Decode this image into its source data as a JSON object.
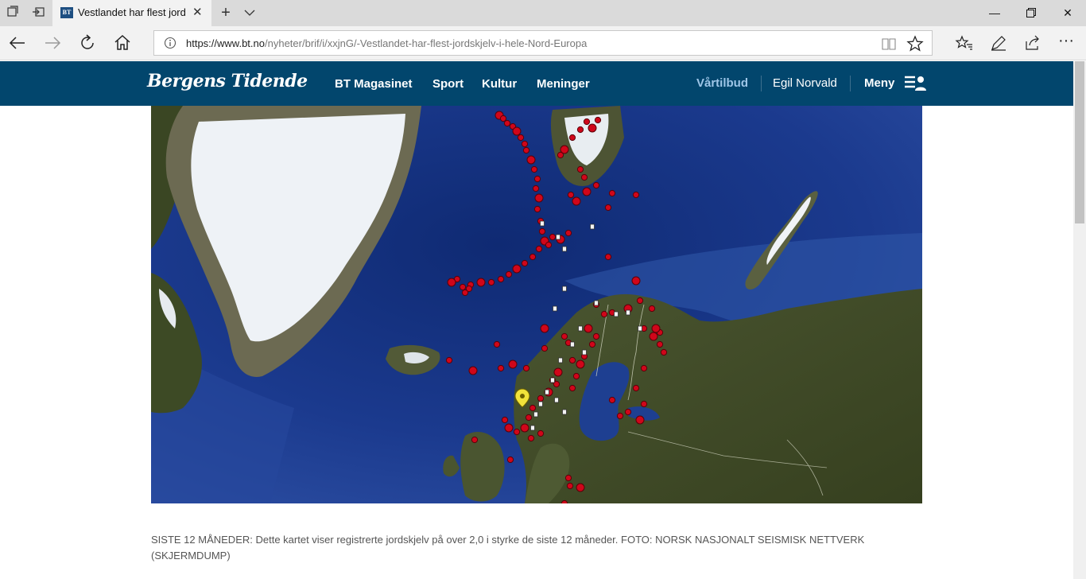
{
  "browser": {
    "tab_title": "Vestlandet har flest jord",
    "url_domain": "https://www.bt.no",
    "url_path": "/nyheter/brif/i/xxjnG/-Vestlandet-har-flest-jordskjelv-i-hele-Nord-Europa",
    "favicon_text": "BT"
  },
  "site": {
    "logo_text": "Bergens Tidende",
    "nav": [
      "BT Magasinet",
      "Sport",
      "Kultur",
      "Meninger"
    ],
    "vartilbud": "Vårtilbud",
    "user_name": "Egil Norvald",
    "menu_label": "Meny"
  },
  "article": {
    "caption": "SISTE 12 MÅNEDER: Dette kartet viser registrerte jordskjelv på over 2,0 i styrke de siste 12 måneder. FOTO: NORSK NASJONALT SEISMISK NETTVERK (SKJERMDUMP)"
  },
  "colors": {
    "header_bg": "#02466d",
    "quake_red": "#d0061a",
    "ocean": "#1f3b8f",
    "land": "#3c4a26",
    "ice": "#eef2f6"
  },
  "icons": [
    "tab-list-icon",
    "set-aside-icon",
    "close-icon",
    "plus-icon",
    "chevron-down-icon",
    "minimize-icon",
    "restore-icon",
    "close-window-icon",
    "back-icon",
    "forward-icon",
    "refresh-icon",
    "home-icon",
    "info-icon",
    "reading-view-icon",
    "favorite-star-icon",
    "favorites-hub-icon",
    "notes-pen-icon",
    "share-icon",
    "more-icon",
    "user-menu-icon"
  ]
}
